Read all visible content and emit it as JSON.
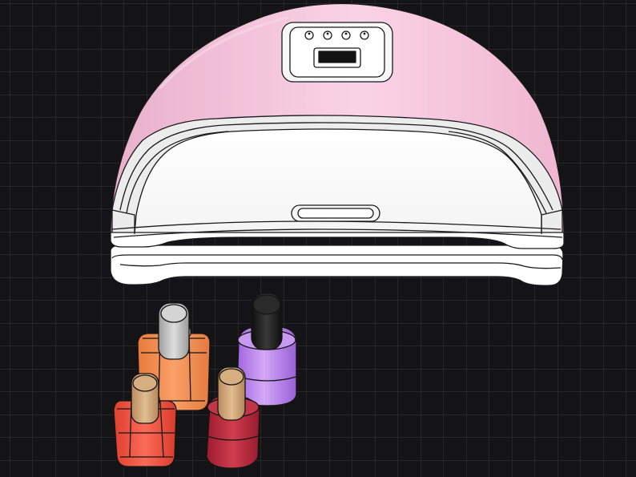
{
  "scene": {
    "background": "#141416",
    "grid_color": "#3a3a3e",
    "lamp": {
      "shell_color": "#f3c6dc",
      "body_color": "#ffffff",
      "outline_color": "#1a1a1a",
      "control_buttons": 4,
      "display": "lcd"
    },
    "bottles": [
      {
        "name": "orange",
        "body": "#f2894a",
        "cap": "#bdbdbd"
      },
      {
        "name": "purple",
        "body": "#b07ae6",
        "cap": "#1b1b1b"
      },
      {
        "name": "red",
        "body": "#ee5040",
        "cap": "#cfa57a"
      },
      {
        "name": "crimson",
        "body": "#b82438",
        "cap": "#cfa57a"
      }
    ]
  }
}
